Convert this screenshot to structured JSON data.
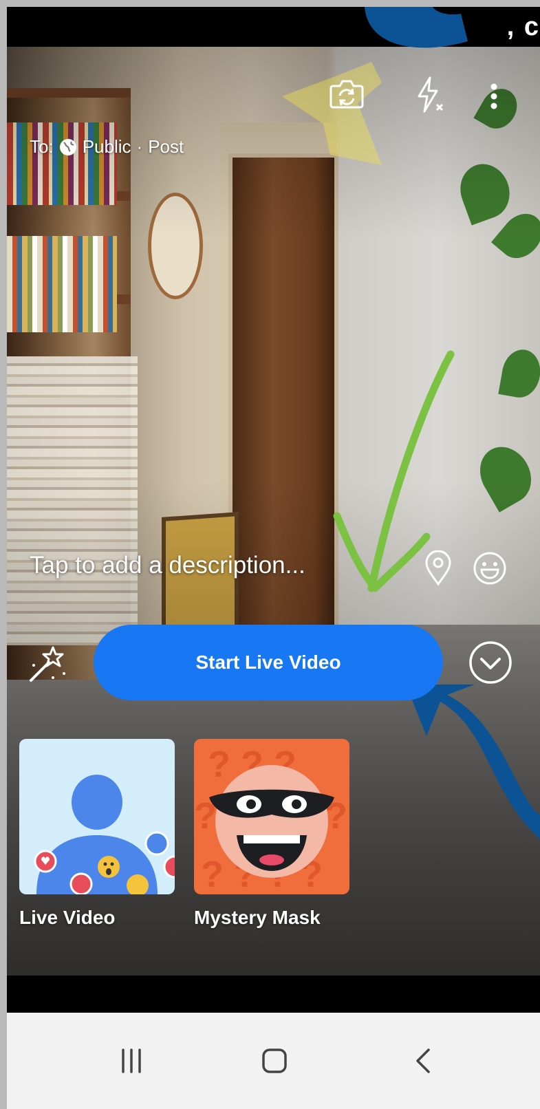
{
  "status_bar": {
    "partial_text": ", c"
  },
  "header": {
    "audience_prefix": "To:",
    "audience": "Public",
    "separator": "·",
    "destination": "Post"
  },
  "toolbar": {
    "flip_camera_icon": "camera-flip-icon",
    "flash_icon": "flash-off-icon",
    "more_icon": "more-vertical-icon"
  },
  "composer": {
    "description_placeholder": "Tap to add a description...",
    "location_icon": "location-pin-icon",
    "emoji_icon": "smiley-icon"
  },
  "actions": {
    "effects_icon": "magic-wand-icon",
    "start_label": "Start Live Video",
    "expand_icon": "chevron-down-circle-icon"
  },
  "effects": [
    {
      "label": "Live Video"
    },
    {
      "label": "Mystery Mask"
    }
  ],
  "navbar": {
    "recents_icon": "recents-icon",
    "home_icon": "home-icon",
    "back_icon": "back-icon"
  },
  "colors": {
    "primary": "#1877f2",
    "annotation_yellow": "#f0e050",
    "annotation_green": "#7cc242",
    "annotation_blue": "#0b5394"
  }
}
